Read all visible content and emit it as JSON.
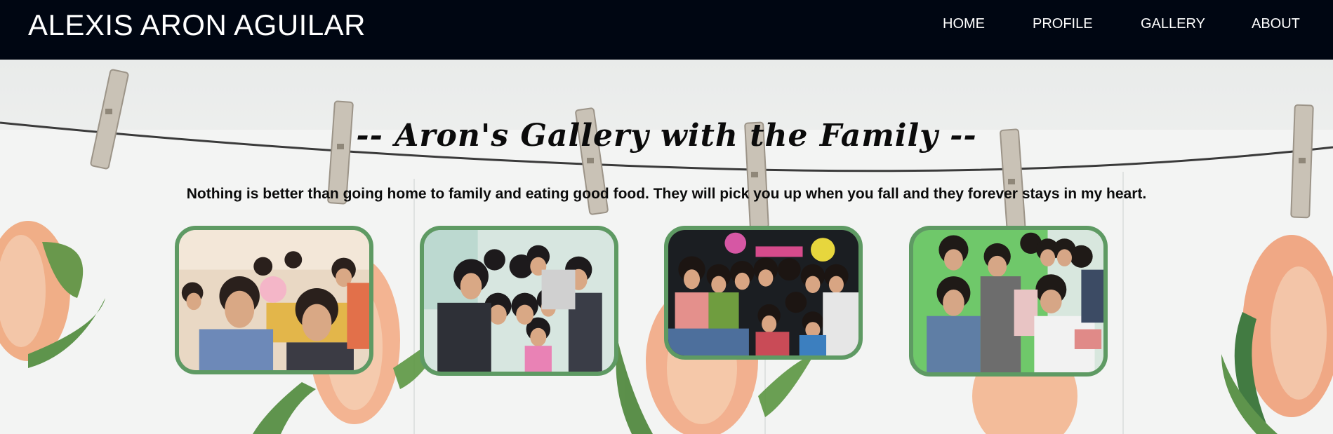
{
  "header": {
    "brand": "ALEXIS ARON AGUILAR",
    "nav": [
      "HOME",
      "PROFILE",
      "GALLERY",
      "ABOUT"
    ]
  },
  "gallery": {
    "title": "-- Aron's Gallery with the Family --",
    "tagline": "Nothing is better than going home to family and eating good food. They will pick you up when you fall and they forever stays in my heart.",
    "photos": [
      "family-photo-1",
      "family-photo-2",
      "family-photo-3",
      "family-photo-4"
    ]
  },
  "colors": {
    "navbar": "#000612",
    "photo_border": "#5e9a63",
    "background": "#eef0ef"
  }
}
